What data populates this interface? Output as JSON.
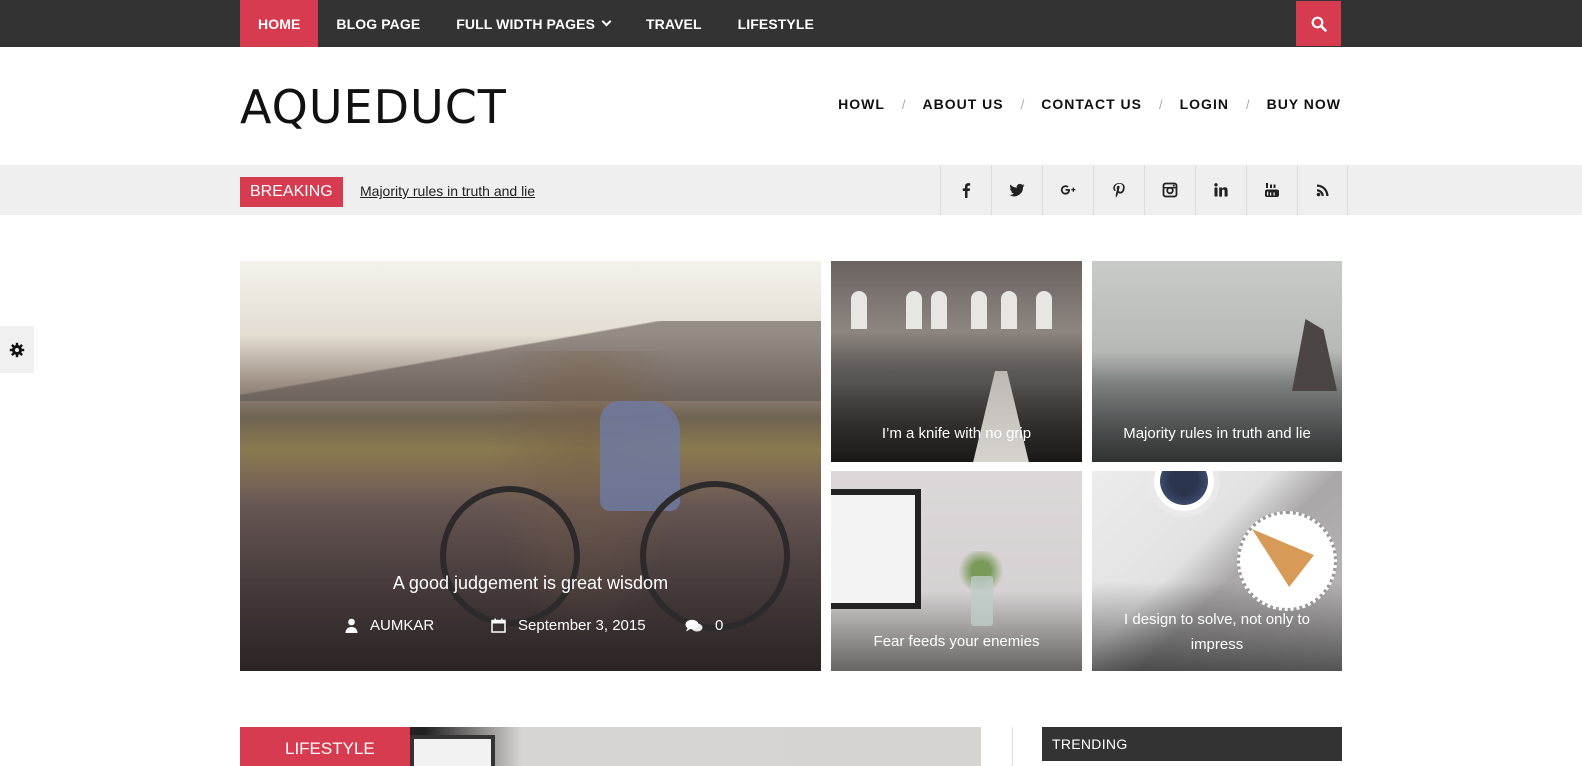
{
  "top_nav": {
    "items": [
      {
        "label": "HOME"
      },
      {
        "label": "BLOG PAGE"
      },
      {
        "label": "FULL WIDTH PAGES"
      },
      {
        "label": "TRAVEL"
      },
      {
        "label": "LIFESTYLE"
      }
    ]
  },
  "header": {
    "logo": "AQUEDUCT",
    "nav": [
      "HOWL",
      "ABOUT US",
      "CONTACT US",
      "LOGIN",
      "BUY NOW"
    ]
  },
  "breaking": {
    "label": "BREAKING",
    "headline": "Majority rules in truth and lie"
  },
  "social_icons": [
    "facebook-icon",
    "twitter-icon",
    "google-plus-icon",
    "pinterest-icon",
    "instagram-icon",
    "linkedin-icon",
    "youtube-icon",
    "rss-icon"
  ],
  "featured": {
    "main": {
      "title": "A good judgement is great wisdom",
      "author": "AUMKAR",
      "date": "September 3, 2015",
      "comments": "0"
    },
    "grid": [
      {
        "title": "I’m a knife with no grip"
      },
      {
        "title": "Majority rules in truth and lie"
      },
      {
        "title": "Fear feeds your enemies"
      },
      {
        "title": "I design to solve, not only to impress"
      }
    ]
  },
  "sections": {
    "category_label": "LIFESTYLE",
    "sidebar_title": "TRENDING"
  },
  "colors": {
    "accent": "#d63b4f",
    "topbar": "#333333",
    "breaking_bg": "#efefef"
  }
}
